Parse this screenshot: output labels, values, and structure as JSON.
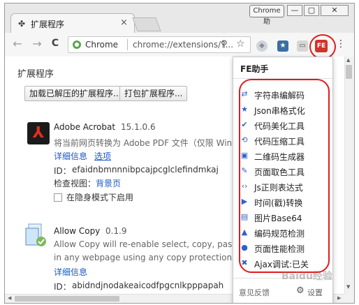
{
  "window": {
    "badge": "Chrome助",
    "controls": {
      "minimize": "—",
      "maximize": "▢",
      "close": "✕"
    }
  },
  "tab": {
    "title": "扩展程序",
    "close": "×"
  },
  "toolbar": {
    "back": "←",
    "forward": "→",
    "reload": "C",
    "scheme": "Chrome",
    "url": "chrome://extensions/?...",
    "fe_label": "FE",
    "menu": "⋮"
  },
  "page": {
    "title": "扩展程序",
    "load_unpacked_button": "加载已解压的扩展程序...",
    "pack_button": "打包扩展程序...",
    "extensions": [
      {
        "name": "Adobe Acrobat",
        "version": "15.1.0.6",
        "description": "将当前网页转换为 Adobe PDF 文件（仅限 Windows）",
        "details_link": "详细信息",
        "options_link": "选项",
        "id_label": "ID：",
        "id": "efaidnbmnnnibpcajpcglclefindmkaj",
        "inspect_label": "检查视图：",
        "inspect_link": "背景页",
        "incognito_label": "在隐身模式下启用"
      },
      {
        "name": "Allow Copy",
        "version": "0.1.9",
        "description_line1": "Allow Copy will re-enable select, copy, paste and right",
        "description_line2": "in any webpage using any copy protection.",
        "details_link": "详细信息",
        "id_label": "ID：",
        "id": "abidndjnodakeaicodfpgcnlkpppapah"
      }
    ]
  },
  "popup": {
    "title": "FE助手",
    "tools": [
      {
        "icon": "encode-icon",
        "glyph": "⇄",
        "label": "字符串编解码"
      },
      {
        "icon": "star-icon",
        "glyph": "★",
        "label": "Json串格式化"
      },
      {
        "icon": "check-icon",
        "glyph": "✔",
        "label": "代码美化工具"
      },
      {
        "icon": "compress-icon",
        "glyph": "⟲",
        "label": "代码压缩工具"
      },
      {
        "icon": "qrcode-icon",
        "glyph": "▣",
        "label": "二维码生成器"
      },
      {
        "icon": "eyedropper-icon",
        "glyph": "✎",
        "label": "页面取色工具"
      },
      {
        "icon": "code-icon",
        "glyph": "‹›",
        "label": "Js正则表达式"
      },
      {
        "icon": "play-icon",
        "glyph": "▶",
        "label": "时间(戳)转换"
      },
      {
        "icon": "image-icon",
        "glyph": "▤",
        "label": "图片Base64"
      },
      {
        "icon": "warning-icon",
        "glyph": "▲",
        "label": "编码规范检测"
      },
      {
        "icon": "speed-icon",
        "glyph": "●",
        "label": "页面性能检测"
      },
      {
        "icon": "close-icon",
        "glyph": "✖",
        "label": "Ajax调试:已关"
      }
    ],
    "footer": {
      "feedback": "意见反馈",
      "settings": "设置"
    }
  },
  "watermark": "Baidu经验",
  "colors": {
    "highlight_ring": "#e11a1a",
    "link": "#1a57c3",
    "tool_icon": "#2d63c8"
  }
}
